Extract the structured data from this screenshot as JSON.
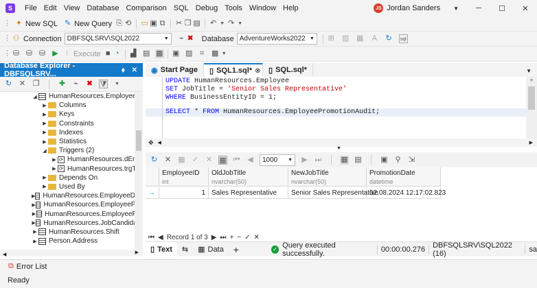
{
  "app": {
    "menu": [
      "File",
      "Edit",
      "View",
      "Database",
      "Comparison",
      "SQL",
      "Debug",
      "Tools",
      "Window",
      "Help"
    ],
    "user": "Jordan Sanders",
    "user_initials": "JS"
  },
  "toolbar1": {
    "new_sql": "New SQL",
    "new_query": "New Query"
  },
  "toolbar2": {
    "connection_label": "Connection",
    "connection_value": "DBFSQLSRV\\SQL2022",
    "database_label": "Database",
    "database_value": "AdventureWorks2022"
  },
  "toolbar3": {
    "execute": "Execute"
  },
  "explorer": {
    "title": "Database Explorer - DBFSQLSRV...",
    "items": [
      {
        "label": "HumanResources.Employee",
        "indent": 0,
        "icon": "table",
        "arrow": "open"
      },
      {
        "label": "Columns",
        "indent": 1,
        "icon": "folder",
        "arrow": "closed"
      },
      {
        "label": "Keys",
        "indent": 1,
        "icon": "folder",
        "arrow": "closed"
      },
      {
        "label": "Constraints",
        "indent": 1,
        "icon": "folder",
        "arrow": "closed"
      },
      {
        "label": "Indexes",
        "indent": 1,
        "icon": "folder",
        "arrow": "closed"
      },
      {
        "label": "Statistics",
        "indent": 1,
        "icon": "folder",
        "arrow": "closed"
      },
      {
        "label": "Triggers (2)",
        "indent": 1,
        "icon": "folder",
        "arrow": "open"
      },
      {
        "label": "HumanResources.dEmp",
        "indent": 2,
        "icon": "trigger",
        "arrow": "closed"
      },
      {
        "label": "HumanResources.trgTr",
        "indent": 2,
        "icon": "trigger",
        "arrow": "closed"
      },
      {
        "label": "Depends On",
        "indent": 1,
        "icon": "folder",
        "arrow": "closed"
      },
      {
        "label": "Used By",
        "indent": 1,
        "icon": "folder",
        "arrow": "closed"
      },
      {
        "label": "HumanResources.EmployeeDep",
        "indent": 0,
        "icon": "table",
        "arrow": "closed"
      },
      {
        "label": "HumanResources.EmployeePay",
        "indent": 0,
        "icon": "table",
        "arrow": "closed"
      },
      {
        "label": "HumanResources.EmployeePro",
        "indent": 0,
        "icon": "table",
        "arrow": "closed"
      },
      {
        "label": "HumanResources.JobCandidate",
        "indent": 0,
        "icon": "table",
        "arrow": "closed"
      },
      {
        "label": "HumanResources.Shift",
        "indent": 0,
        "icon": "table",
        "arrow": "closed"
      },
      {
        "label": "Person.Address",
        "indent": 0,
        "icon": "table",
        "arrow": "closed"
      }
    ]
  },
  "tabs": [
    {
      "label": "Start Page"
    },
    {
      "label": "SQL1.sql*"
    },
    {
      "label": "SQL.sql*"
    }
  ],
  "editor": {
    "l1a": "UPDATE",
    "l1b": " HumanResources.Employee",
    "l2a": "SET",
    "l2b": " JobTitle = ",
    "l2c": "'Senior Sales Representative'",
    "l3a": "WHERE",
    "l3b": " BusinessEntityID = 1;",
    "l4a": "SELECT",
    "l4b": " * ",
    "l4c": "FROM",
    "l4d": " HumanResources.EmployeePromotionAudit;"
  },
  "grid": {
    "page_size": "1000",
    "columns": [
      {
        "name": "EmployeeID",
        "type": "int"
      },
      {
        "name": "OldJobTitle",
        "type": "nvarchar(50)"
      },
      {
        "name": "NewJobTitle",
        "type": "nvarchar(50)"
      },
      {
        "name": "PromotionDate",
        "type": "datetime"
      }
    ],
    "row": [
      "1",
      "Sales Representative",
      "Senior Sales Representative",
      "02.08.2024 12:17:02.823"
    ],
    "record_text": "Record 1 of 3"
  },
  "bottom": {
    "text_tab": "Text",
    "data_tab": "Data",
    "status_msg": "Query executed successfully.",
    "elapsed": "00:00:00.276",
    "server": "DBFSQLSRV\\SQL2022 (16)",
    "user": "sa"
  },
  "status": {
    "error_list": "Error List",
    "ready": "Ready"
  }
}
